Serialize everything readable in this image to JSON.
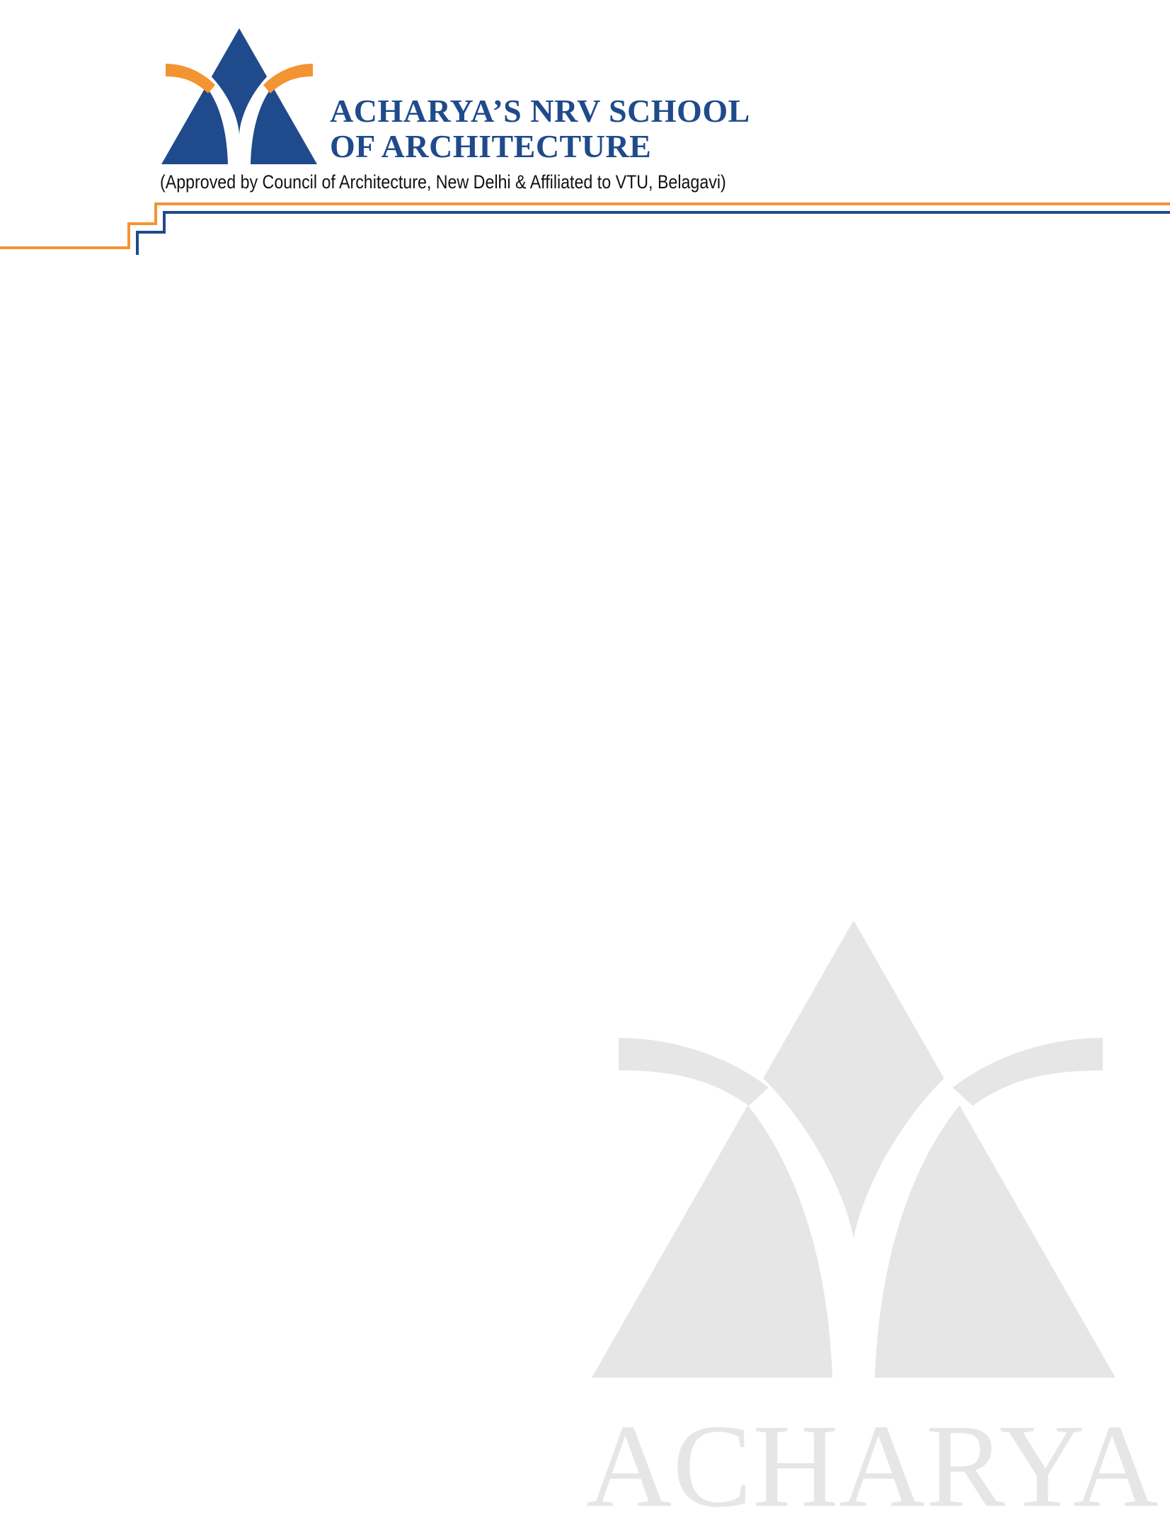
{
  "header": {
    "school_name_line1": "ACHARYA’S NRV SCHOOL",
    "school_name_line2": "OF ARCHITECTURE",
    "approval_text": "(Approved by Council of Architecture, New Delhi & Affiliated to VTU, Belagavi)"
  },
  "watermark": {
    "word": "ACHARYA"
  },
  "colors": {
    "brand_blue": "#1f4a8c",
    "brand_orange": "#f39433",
    "watermark_gray": "#e6e6e6"
  },
  "icons": {
    "logo": "acharya-triangle-arch-logo",
    "watermark_logo": "acharya-triangle-arch-logo-watermark"
  }
}
